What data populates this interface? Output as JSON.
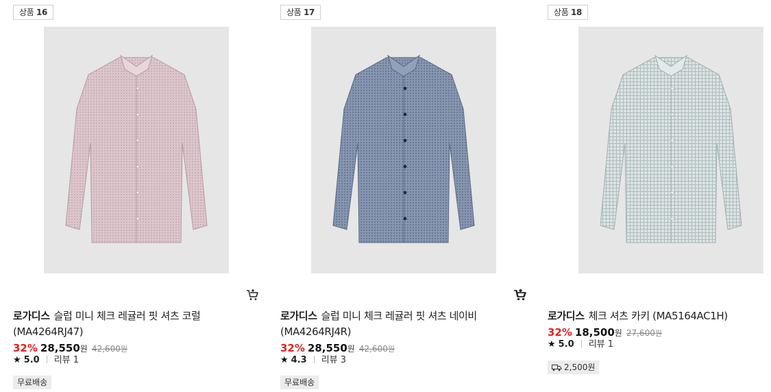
{
  "products": [
    {
      "badge_prefix": "상품",
      "badge_number": "16",
      "brand": "로가디스",
      "name": "슬럽 미니 체크 레귤러 핏 셔츠 코럴 (MA4264RJ47)",
      "discount": "32%",
      "sale_price": "28,550",
      "currency": "원",
      "original_price": "42,600",
      "original_currency": "원",
      "rating": "5.0",
      "review_label": "리뷰 1",
      "tag": "무료배송",
      "shirt_color": "#d9c3c9"
    },
    {
      "badge_prefix": "상품",
      "badge_number": "17",
      "brand": "로가디스",
      "name": "슬럽 미니 체크 레귤러 핏 셔츠 네이비 (MA4264RJ4R)",
      "discount": "32%",
      "sale_price": "28,550",
      "currency": "원",
      "original_price": "42,600",
      "original_currency": "원",
      "rating": "4.3",
      "review_label": "리뷰 3",
      "tag": "무료배송",
      "shirt_color": "#7f8ea8"
    },
    {
      "badge_prefix": "상품",
      "badge_number": "18",
      "brand": "로가디스",
      "name": "체크 셔츠 카키 (MA5164AC1H)",
      "discount": "32%",
      "sale_price": "18,500",
      "currency": "원",
      "original_price": "27,600",
      "original_currency": "원",
      "rating": "5.0",
      "review_label": "리뷰 1",
      "tag": "2,500원",
      "tag_icon": "truck-icon",
      "shirt_color": "#cfd8d9"
    }
  ],
  "icons": {
    "cart": "cart-icon",
    "star": "star-icon"
  },
  "colors": {
    "discount": "#e02020",
    "thumb_bg": "#e6e6e6"
  }
}
